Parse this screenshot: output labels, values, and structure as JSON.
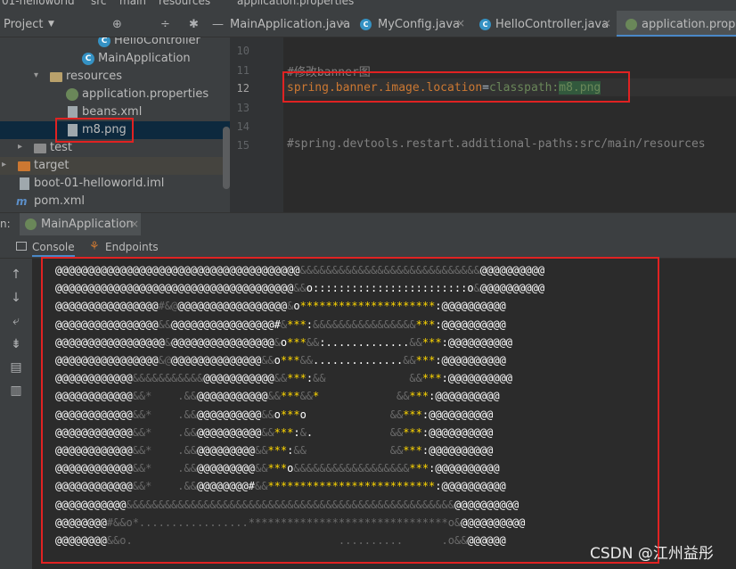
{
  "breadcrumb": [
    "01-helloworld",
    "src",
    "main",
    "resources",
    "application.properties"
  ],
  "project_panel": {
    "title": "Project",
    "tree": [
      {
        "label": "HelloController",
        "icon": "class-icon"
      },
      {
        "label": "MainApplication",
        "icon": "spring-class-icon"
      },
      {
        "label": "resources",
        "icon": "folder-icon",
        "arrow": "▾"
      },
      {
        "label": "application.properties",
        "icon": "spring-leaf-icon"
      },
      {
        "label": "beans.xml",
        "icon": "xml-file-icon"
      },
      {
        "label": "m8.png",
        "icon": "image-file-icon"
      },
      {
        "label": "test",
        "icon": "folder-icon",
        "arrow": "▸"
      },
      {
        "label": "target",
        "icon": "folder-icon",
        "arrow": "▸"
      },
      {
        "label": "boot-01-helloworld.iml",
        "icon": "module-file-icon"
      },
      {
        "label": "pom.xml",
        "icon": "maven-icon"
      }
    ]
  },
  "editor_tabs": [
    {
      "label": "MainApplication.java",
      "icon": "class-icon"
    },
    {
      "label": "MyConfig.java",
      "icon": "class-icon"
    },
    {
      "label": "HelloController.java",
      "icon": "class-icon"
    },
    {
      "label": "application.proper",
      "icon": "spring-leaf-icon",
      "active": true
    }
  ],
  "editor": {
    "line_numbers": [
      "",
      "10",
      "11",
      "12",
      "13",
      "14",
      "15"
    ],
    "lines": {
      "comment_banner": "#修改banner图",
      "key": "spring.banner.image.location",
      "eq": "=",
      "value_prefix": "classpath:",
      "value_file": "m8.png",
      "comment_devtools": "#spring.devtools.restart.additional-paths:src/main/resources"
    }
  },
  "run_panel": {
    "prefix": "n:",
    "run_tab": "MainApplication",
    "subtabs": [
      "Console",
      "Endpoints"
    ]
  },
  "console_lines": [
    {
      "w": "@@@@@@@@@@@@@@@@@@@@@@@@@@@@@@@@@@@@@@",
      "d": "&&&&&&&&&&&&&&&&&&&&&&&&&&&&",
      "y": "",
      "w2": "@@@@@@@@@@"
    },
    {
      "w": "@@@@@@@@@@@@@@@@@@@@@@@@@@@@@@@@@@@@@",
      "d": "&&",
      "y": "",
      "w2": "o::::::::::::::::::::::::o&@@@@@@@@@@"
    },
    {
      "w": "@@@@@@@@@@@@@@@@",
      "d": "#&@",
      "y": "",
      "w2": "@@@@@@@@@@@@@@@@@&o*********************:@@@@@@@@@@"
    },
    {
      "w": "@@@@@@@@@@@@@@@@",
      "d": "&&",
      "y": "",
      "w2": "@@@@@@@@@@@@@@@@#&***:&&&&&&&&&&&&&&&&***:@@@@@@@@@@"
    },
    {
      "w": "@@@@@@@@@@@@@@@@@",
      "d": "&",
      "y": "",
      "w2": "@@@@@@@@@@@@@@@@&o***&&:.............&&***:@@@@@@@@@@"
    },
    {
      "w": "@@@@@@@@@@@@@@@@",
      "d": "&@",
      "y": "",
      "w2": "@@@@@@@@@@@@@@&&o***&&..............&&***:@@@@@@@@@@"
    },
    {
      "w": "@@@@@@@@@@@@",
      "d": "&&&&&&&&&&&",
      "y": "",
      "w2": "@@@@@@@@@@@&&***:&&             &&***:@@@@@@@@@@"
    },
    {
      "w": "@@@@@@@@@@@@",
      "d": "&&*    .&&",
      "y": "",
      "w2": "@@@@@@@@@@@&&***&&*            &&***:@@@@@@@@@@"
    },
    {
      "w": "@@@@@@@@@@@@",
      "d": "&&*    .&&",
      "y": "",
      "w2": "@@@@@@@@@@&&o***o             &&***:@@@@@@@@@@"
    },
    {
      "w": "@@@@@@@@@@@@",
      "d": "&&*    .&&",
      "y": "",
      "w2": "@@@@@@@@@@&&***:&.            &&***:@@@@@@@@@@"
    },
    {
      "w": "@@@@@@@@@@@@",
      "d": "&&*    .&&",
      "y": "",
      "w2": "@@@@@@@@@&&***:&&             &&***:@@@@@@@@@@"
    },
    {
      "w": "@@@@@@@@@@@@",
      "d": "&&*    .&&",
      "y": "",
      "w2": "@@@@@@@@@&&***o&&&&&&&&&&&&&&&&&&***:@@@@@@@@@@"
    },
    {
      "w": "@@@@@@@@@@@@",
      "d": "&&*    .&&",
      "y": "",
      "w2": "@@@@@@@@#&&**************************:@@@@@@@@@@"
    },
    {
      "w": "@@@@@@@@@@@",
      "d": "&&&&&&&&&&&&&&&&&&&&&&&&&&&&&&&&&&&&&&&&&&&&&&&&&&&",
      "y": "",
      "w2": "@@@@@@@@@@"
    },
    {
      "w": "@@@@@@@@",
      "d": "#&&o*.................*******************************o&",
      "y": "",
      "w2": "@@@@@@@@@@"
    },
    {
      "w": "@@@@@@@@",
      "d": "&&o.                                ..........      .o&&",
      "y": "",
      "w2": "@@@@@@"
    }
  ],
  "watermark": "CSDN @江州益彤"
}
